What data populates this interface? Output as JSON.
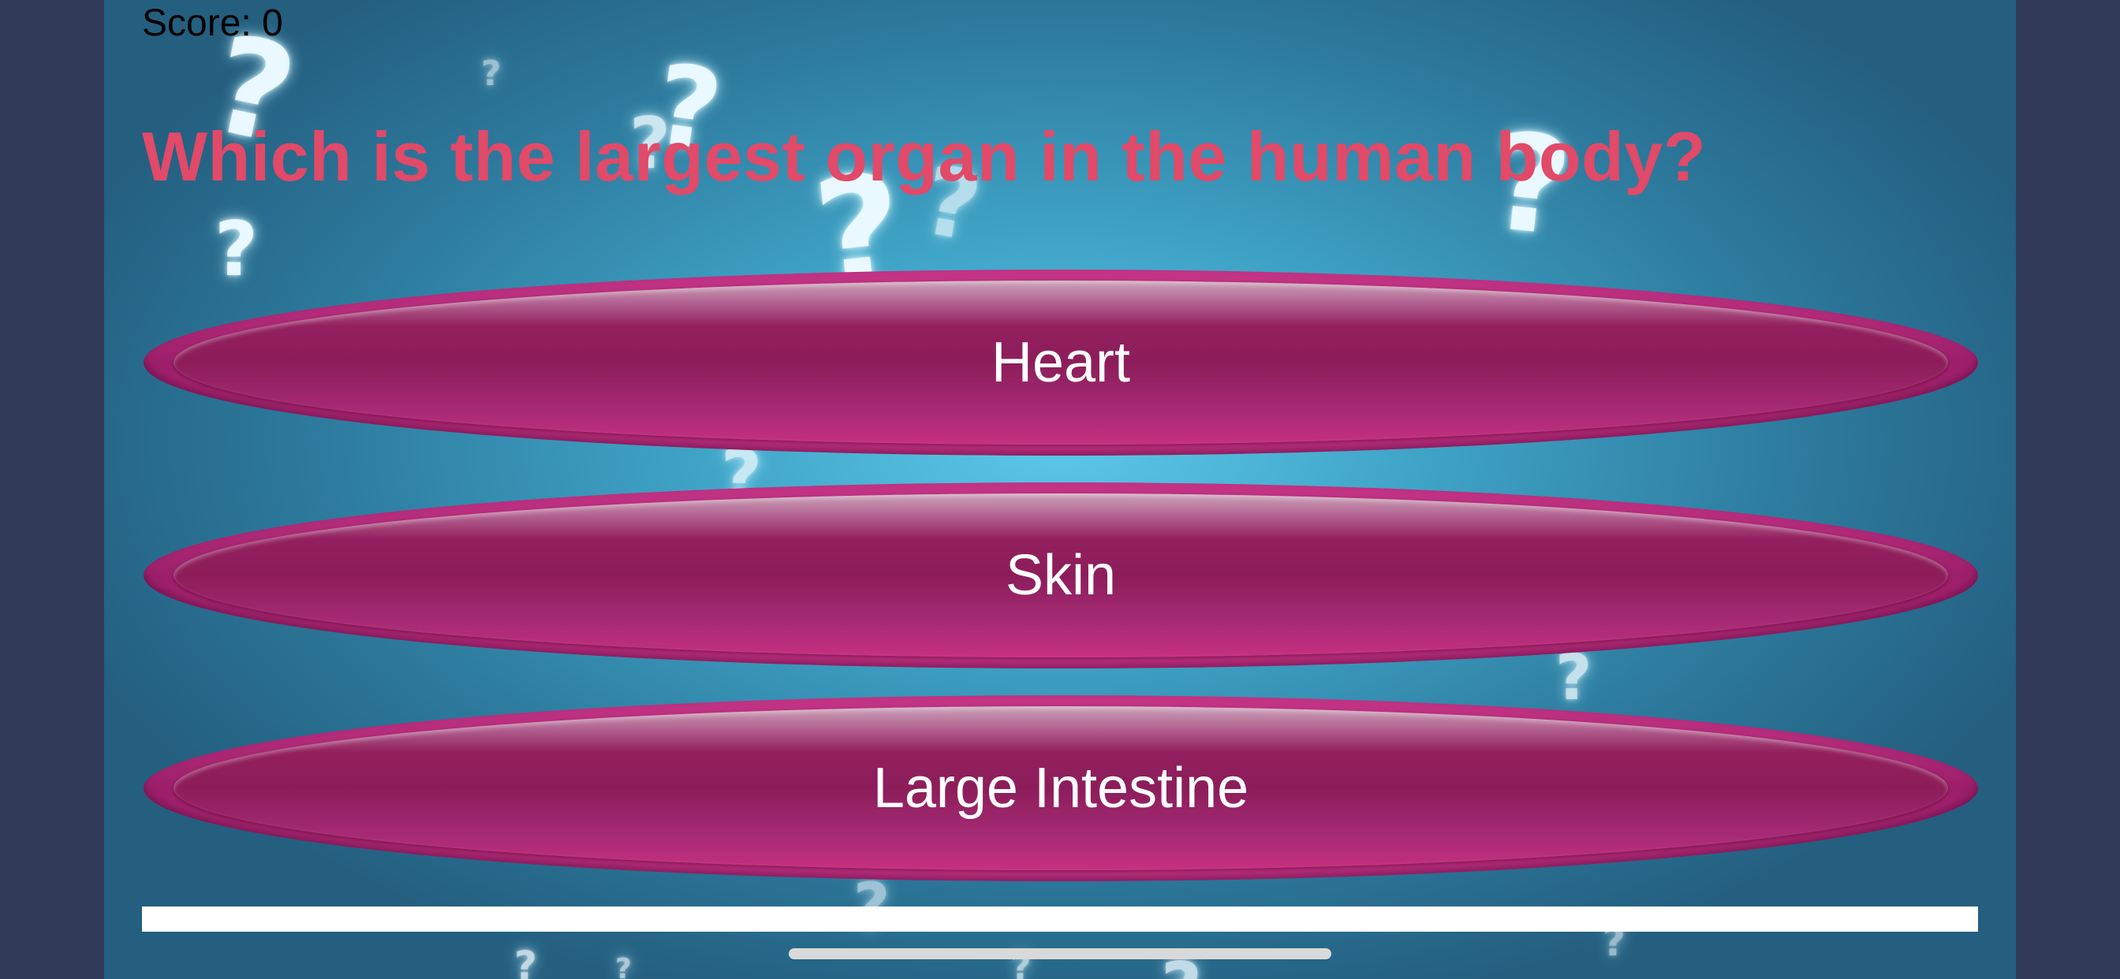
{
  "score": {
    "text": "Score: 0"
  },
  "question": {
    "text": "Which is the largest organ in the human body?"
  },
  "answers": [
    {
      "label": "Heart"
    },
    {
      "label": "Skin"
    },
    {
      "label": "Large Intestine"
    }
  ],
  "progress": {
    "fraction": 1.0
  },
  "background": {
    "icon": "question-mark-pattern"
  },
  "colors": {
    "side_panel": "#323a5a",
    "question_text": "#e14a68",
    "answer_button": "#9c1f6a",
    "progress_bar": "#ffffff"
  }
}
